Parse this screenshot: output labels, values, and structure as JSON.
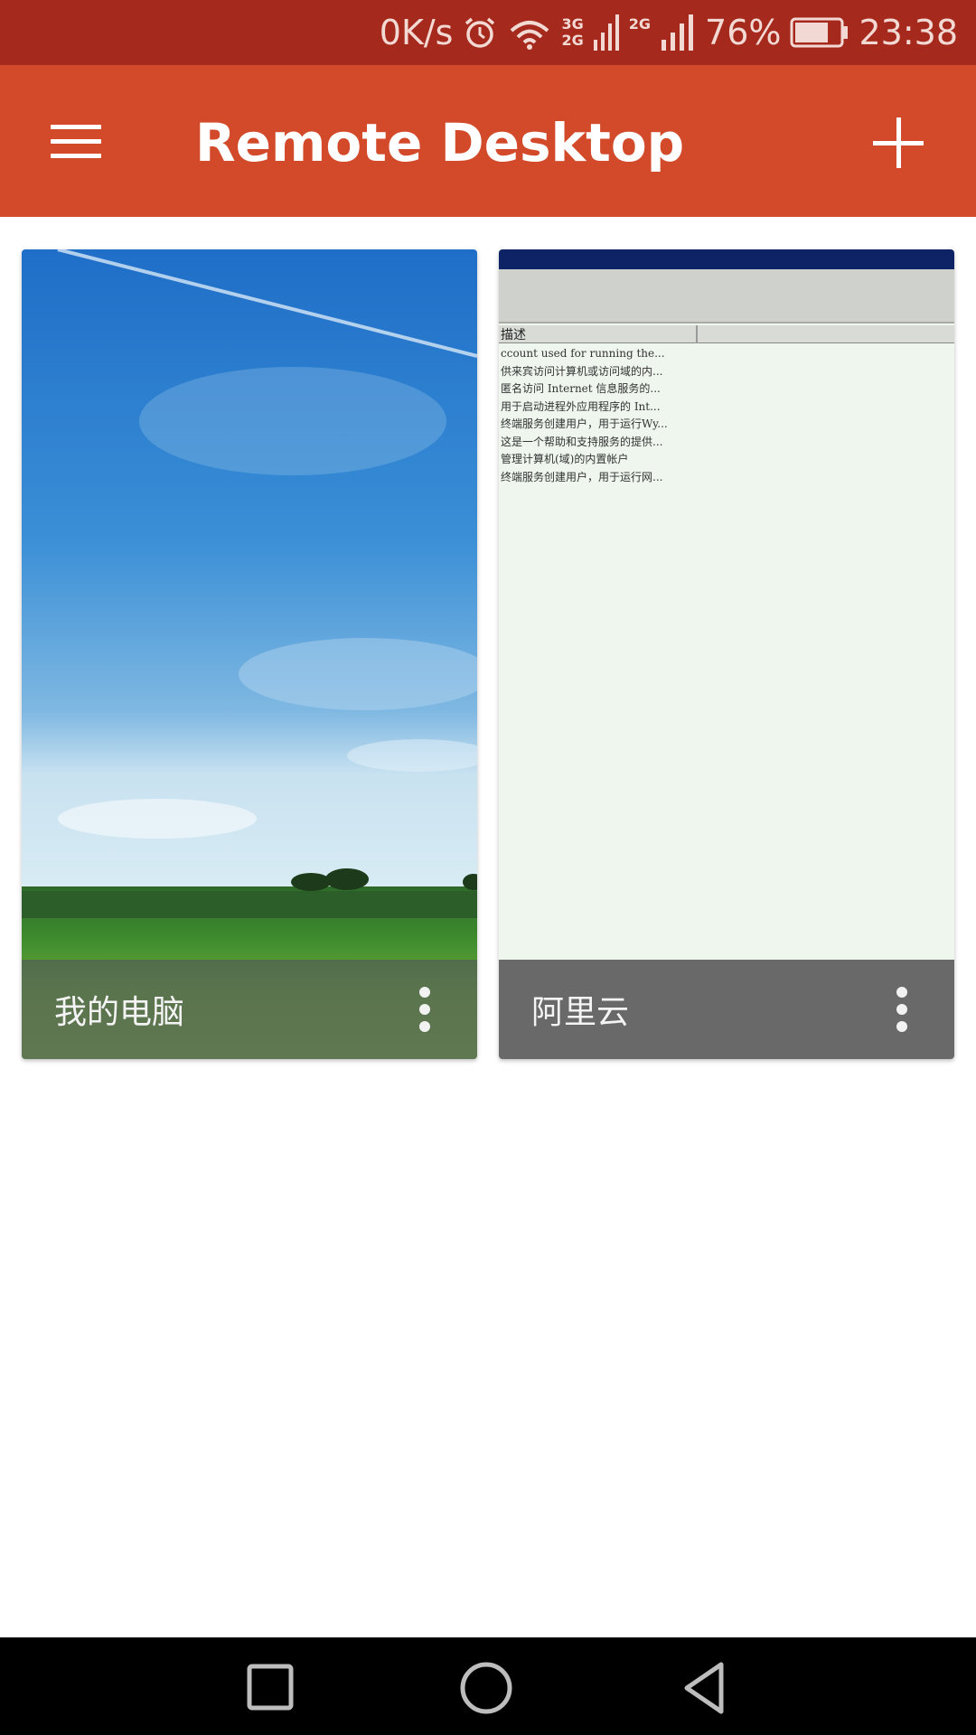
{
  "status_bar": {
    "net_speed": "0K/s",
    "net_type_1_top": "3G",
    "net_type_1_bottom": "2G",
    "net_type_2": "2G",
    "battery": "76%",
    "time": "23:38",
    "battery_level": 0.76,
    "icons": [
      "alarm-icon",
      "wifi-icon",
      "signal-icon",
      "signal-icon",
      "battery-icon"
    ]
  },
  "app_bar": {
    "title": "Remote Desktop",
    "menu_icon": "hamburger-menu-icon",
    "add_icon": "plus-icon"
  },
  "connections": [
    {
      "label": "我的电脑",
      "thumbnail": "sky-and-grass-wallpaper"
    },
    {
      "label": "阿里云",
      "thumbnail": "windows-server-screen",
      "screen": {
        "header": "描述",
        "lines": [
          "ccount used for running the...",
          "供来宾访问计算机或访问域的内...",
          "匿名访问 Internet 信息服务的...",
          "用于启动进程外应用程序的 Int...",
          "终端服务创建用户，用于运行Wy...",
          "这是一个帮助和支持服务的提供...",
          "管理计算机(域)的内置帐户",
          "终端服务创建用户，用于运行网..."
        ]
      }
    }
  ],
  "nav_bar": {
    "recent_icon": "recent-apps-icon",
    "home_icon": "home-icon",
    "back_icon": "back-icon"
  },
  "colors": {
    "status_bar": "#a52a1d",
    "app_bar": "#d24a2a"
  }
}
